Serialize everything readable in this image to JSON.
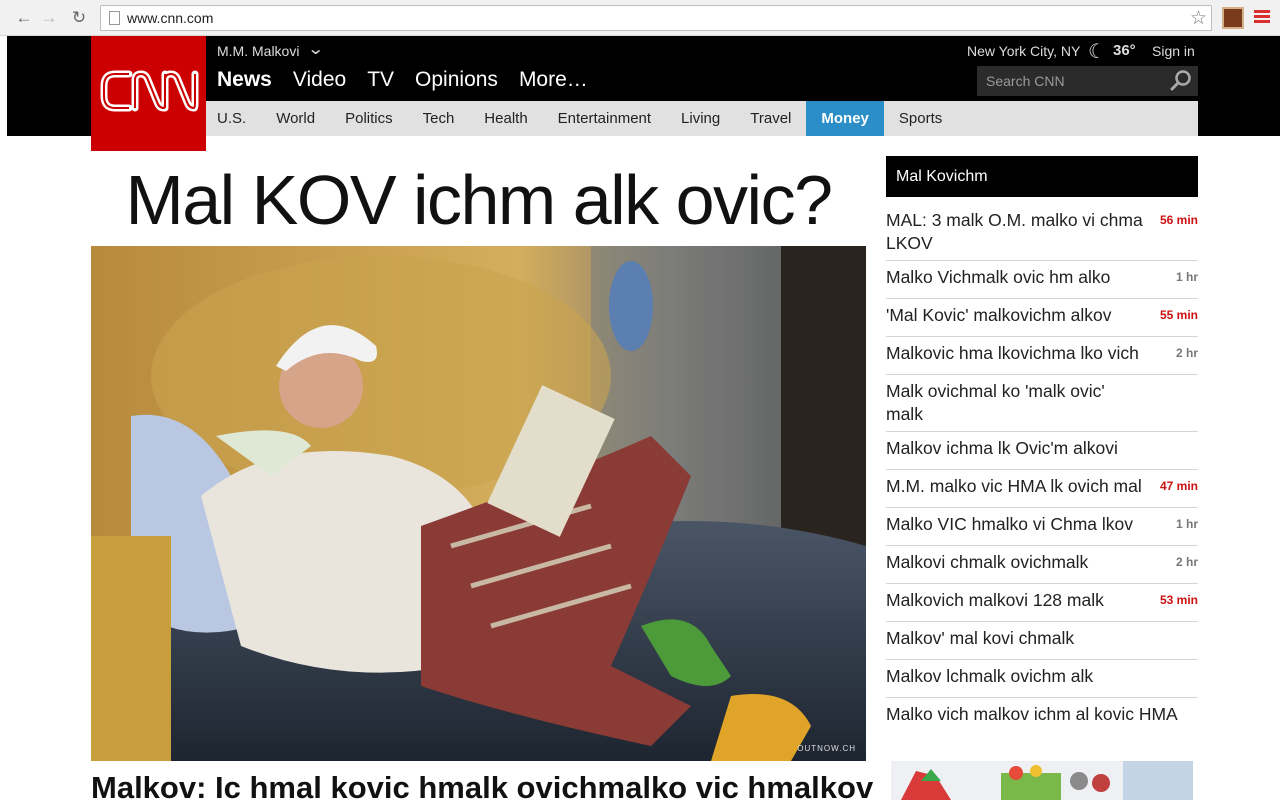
{
  "browser": {
    "url": "www.cnn.com",
    "icons": {
      "back": "arrow-left-icon",
      "forward": "arrow-right-icon",
      "reload": "reload-icon",
      "bookmark": "star-icon",
      "menu": "hamburger-menu-icon"
    }
  },
  "header": {
    "logo_text": "CNN",
    "user_name": "M.M. Malkovi",
    "primary_nav": [
      "News",
      "Video",
      "TV",
      "Opinions",
      "More…"
    ],
    "weather_location": "New York City, NY",
    "temperature": "36°",
    "sign_in": "Sign in",
    "search_placeholder": "Search CNN",
    "sections": [
      "U.S.",
      "World",
      "Politics",
      "Tech",
      "Health",
      "Entertainment",
      "Living",
      "Travel",
      "Money",
      "Sports"
    ],
    "active_section": "Money",
    "colors": {
      "brand_red": "#cc0000",
      "active_section": "#2c8ec7"
    }
  },
  "main": {
    "headline": "Mal KOV ichm alk ovic?",
    "photo_credit": "OUTNOW.CH",
    "story_title": "Malkov: Ic hmal kovic hmalk ovichmalko vic hmalkov"
  },
  "sidebar": {
    "title": "Mal Kovichm",
    "items": [
      {
        "text": "MAL: 3 malk O.M. malko vi chma LKOV",
        "time": "56 min",
        "red": true
      },
      {
        "text": "Malko Vichmalk ovic hm alko",
        "time": "1 hr",
        "red": false
      },
      {
        "text": "'Mal Kovic' malkovichm alkov",
        "time": "55 min",
        "red": true
      },
      {
        "text": "Malkovic hma lkovichma lko vich",
        "time": "2 hr",
        "red": false
      },
      {
        "text": "Malk ovichmal ko 'malk ovic' malk",
        "time": "",
        "red": false
      },
      {
        "text": "Malkov ichma lk Ovic'm alkovi",
        "time": "",
        "red": false
      },
      {
        "text": "M.M. malko vic HMA lk ovich mal",
        "time": "47 min",
        "red": true
      },
      {
        "text": "Malko VIC hmalko vi Chma lkov",
        "time": "1 hr",
        "red": false
      },
      {
        "text": "Malkovi chmalk ovichmalk",
        "time": "2 hr",
        "red": false
      },
      {
        "text": "Malkovich malkovi 128 malk",
        "time": "53 min",
        "red": true
      },
      {
        "text": "Malkov' mal kovi chmalk",
        "time": "",
        "red": false
      },
      {
        "text": "Malkov lchmalk ovichm alk",
        "time": "",
        "red": false
      },
      {
        "text": "Malko vich malkov ichm al kovic HMA",
        "time": "",
        "red": false
      }
    ]
  }
}
